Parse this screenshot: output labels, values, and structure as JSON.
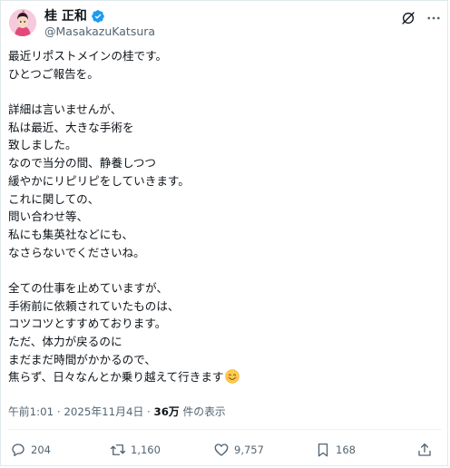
{
  "author": {
    "display_name": "桂 正和",
    "handle": "@MasakazuKatsura",
    "avatar_icon": "avatar-illustration",
    "verified_icon": "verified-badge-icon",
    "verified_color": "#1d9bf0"
  },
  "header_actions": {
    "grok_icon": "grok-icon",
    "more_icon": "more-icon"
  },
  "tweet": {
    "lines": [
      "最近リポストメインの桂です。",
      "ひとつご報告を。",
      "",
      "詳細は言いませんが、",
      "私は最近、大きな手術を",
      "致しました。",
      "なので当分の間、静養しつつ",
      "緩やかにリピリピをしていきます。",
      "これに関しての、",
      "問い合わせ等、",
      "私にも集英社などにも、",
      "なさらないでくださいね。",
      "",
      "全ての仕事を止めていますが、",
      "手術前に依頼されていたものは、",
      "コツコツとすすめております。",
      "ただ、体力が戻るのに",
      "まだまだ時間がかかるので、",
      "焦らず、日々なんとか乗り越えて行きます"
    ],
    "trailing_emoji": "smiling-face-emoji"
  },
  "meta": {
    "timestamp": "午前1:01 · 2025年11月4日 · ",
    "views_count": "36万",
    "views_suffix": " 件の表示"
  },
  "actions": {
    "reply_count": "204",
    "repost_count": "1,160",
    "like_count": "9,757",
    "bookmark_count": "168"
  },
  "colors": {
    "text_primary": "#0f1419",
    "text_secondary": "#536471",
    "border": "#e1e8ed",
    "accent": "#1d9bf0"
  }
}
